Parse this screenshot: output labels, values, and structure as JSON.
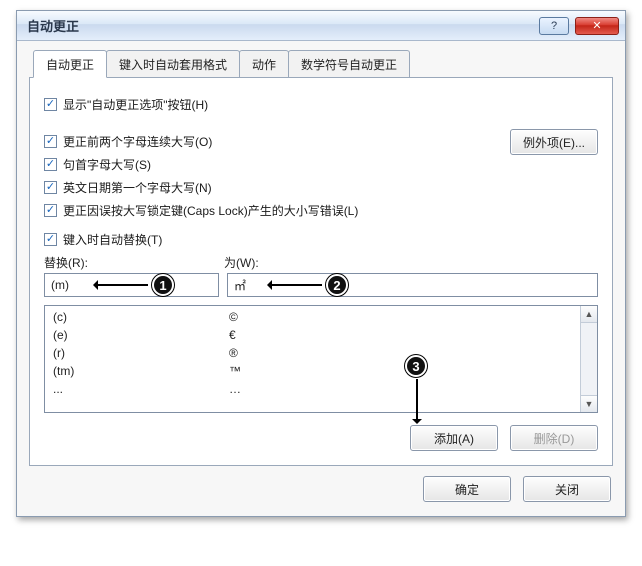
{
  "titlebar": {
    "title": "自动更正"
  },
  "tabs": [
    {
      "label": "自动更正",
      "active": true
    },
    {
      "label": "键入时自动套用格式",
      "active": false
    },
    {
      "label": "动作",
      "active": false
    },
    {
      "label": "数学符号自动更正",
      "active": false
    }
  ],
  "options": {
    "show_button": "显示\"自动更正选项\"按钮(H)",
    "two_caps": "更正前两个字母连续大写(O)",
    "cap_sentence": "句首字母大写(S)",
    "cap_days": "英文日期第一个字母大写(N)",
    "caps_lock": "更正因误按大写锁定键(Caps Lock)产生的大小写错误(L)",
    "replace_as_type": "键入时自动替换(T)"
  },
  "exceptions_button": "例外项(E)...",
  "replace_section": {
    "label_replace": "替换(R):",
    "label_with": "为(W):",
    "replace_value": "(m)",
    "with_value": "㎡"
  },
  "list": [
    {
      "from": "(c)",
      "to": "©"
    },
    {
      "from": "(e)",
      "to": "€"
    },
    {
      "from": "(r)",
      "to": "®"
    },
    {
      "from": "(tm)",
      "to": "™"
    },
    {
      "from": "...",
      "to": "…"
    }
  ],
  "buttons": {
    "add": "添加(A)",
    "delete": "删除(D)",
    "ok": "确定",
    "close": "关闭"
  },
  "callouts": {
    "c1": "1",
    "c2": "2",
    "c3": "3"
  }
}
